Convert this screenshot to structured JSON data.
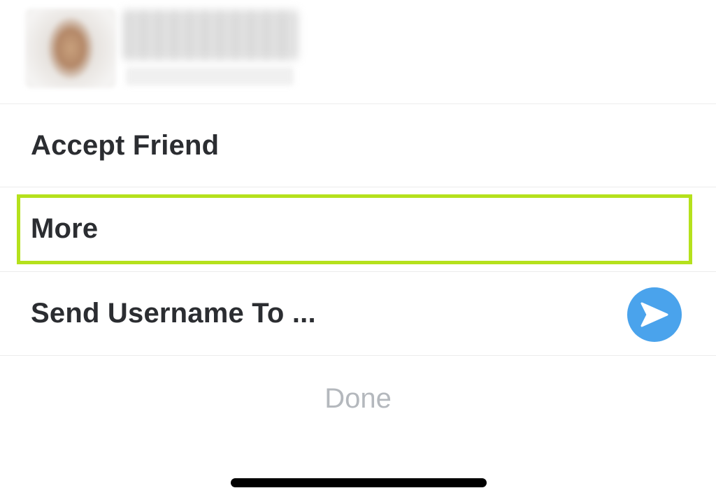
{
  "profile": {
    "avatar_icon": "blurred-avatar",
    "name_blurred": true
  },
  "menu": {
    "items": [
      {
        "label": "Accept Friend"
      },
      {
        "label": "More",
        "highlighted": true
      },
      {
        "label": "Send Username To ...",
        "icon": "send-arrow-icon"
      }
    ],
    "done_label": "Done"
  },
  "colors": {
    "highlight": "#b5e11c",
    "send_icon_bg": "#4aa3ec",
    "text_primary": "#2b2d31",
    "done_text": "#b4b8bd"
  }
}
